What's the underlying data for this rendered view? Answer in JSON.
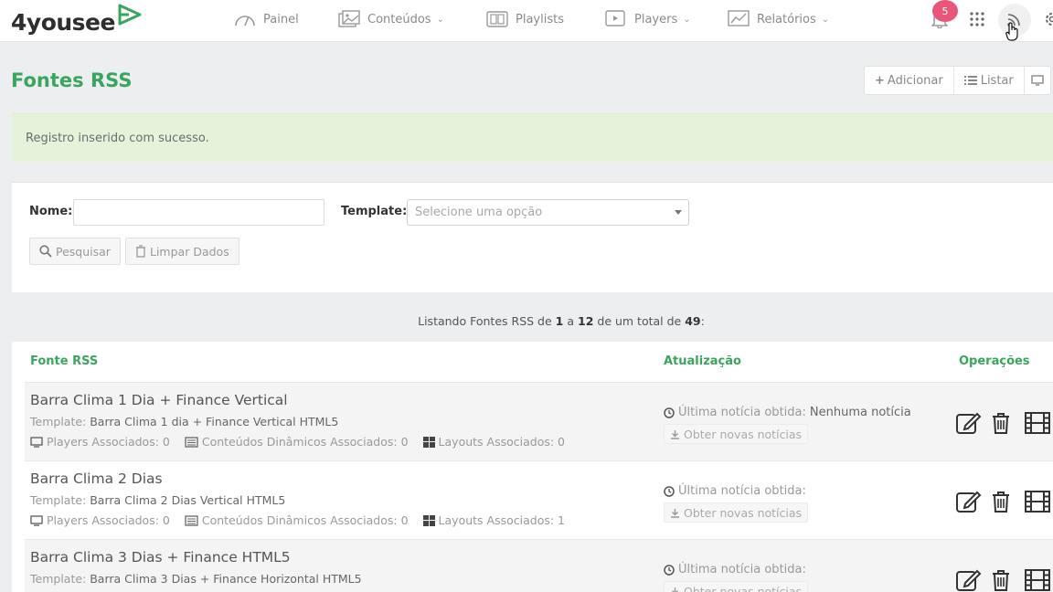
{
  "brand": {
    "name": "4yousee",
    "accent": "#3aa55d"
  },
  "nav": {
    "items": [
      {
        "label": "Painel",
        "icon": "gauge-icon"
      },
      {
        "label": "Conteúdos",
        "icon": "images-icon",
        "dropdown": true
      },
      {
        "label": "Playlists",
        "icon": "playlist-icon"
      },
      {
        "label": "Players",
        "icon": "player-icon",
        "dropdown": true
      },
      {
        "label": "Relatórios",
        "icon": "chart-icon",
        "dropdown": true
      }
    ],
    "notifications_count": "5"
  },
  "page": {
    "title": "Fontes RSS",
    "actions": {
      "add": "Adicionar",
      "list": "Listar"
    }
  },
  "alert": {
    "message": "Registro inserido com sucesso.",
    "color": "#e4f3d9"
  },
  "filter": {
    "name_label": "Nome:",
    "name_value": "",
    "template_label": "Template:",
    "template_placeholder": "Selecione uma opção",
    "search_label": "Pesquisar",
    "clear_label": "Limpar Dados"
  },
  "listing": {
    "prefix": "Listando Fontes RSS de",
    "from": "1",
    "sep1": "a",
    "to": "12",
    "sep2": "de um total de",
    "total": "49",
    "suffix": ":"
  },
  "table": {
    "headers": {
      "source": "Fonte RSS",
      "update": "Atualização",
      "operations": "Operações"
    },
    "rows": [
      {
        "name": "Barra Clima 1 Dia + Finance Vertical",
        "template_label": "Template:",
        "template": "Barra Clima 1 dia + Finance Vertical HTML5",
        "players": "Players Associados: 0",
        "dynamic": "Conteúdos Dinâmicos Associados: 0",
        "layouts": "Layouts Associados: 0",
        "last_label": "Última notícia obtida:",
        "last_value": "Nenhuma notícia",
        "fetch_label": "Obter novas notícias"
      },
      {
        "name": "Barra Clima 2 Dias",
        "template_label": "Template:",
        "template": "Barra Clima 2 Dias Vertical HTML5",
        "players": "Players Associados: 0",
        "dynamic": "Conteúdos Dinâmicos Associados: 0",
        "layouts": "Layouts Associados: 1",
        "last_label": "Última notícia obtida:",
        "last_value": "",
        "fetch_label": "Obter novas notícias"
      },
      {
        "name": "Barra Clima 3 Dias + Finance HTML5",
        "template_label": "Template:",
        "template": "Barra Clima 3 Dias + Finance Horizontal HTML5",
        "last_label": "Última notícia obtida:",
        "last_value": "",
        "fetch_label": "Obter novas notícias"
      }
    ]
  }
}
